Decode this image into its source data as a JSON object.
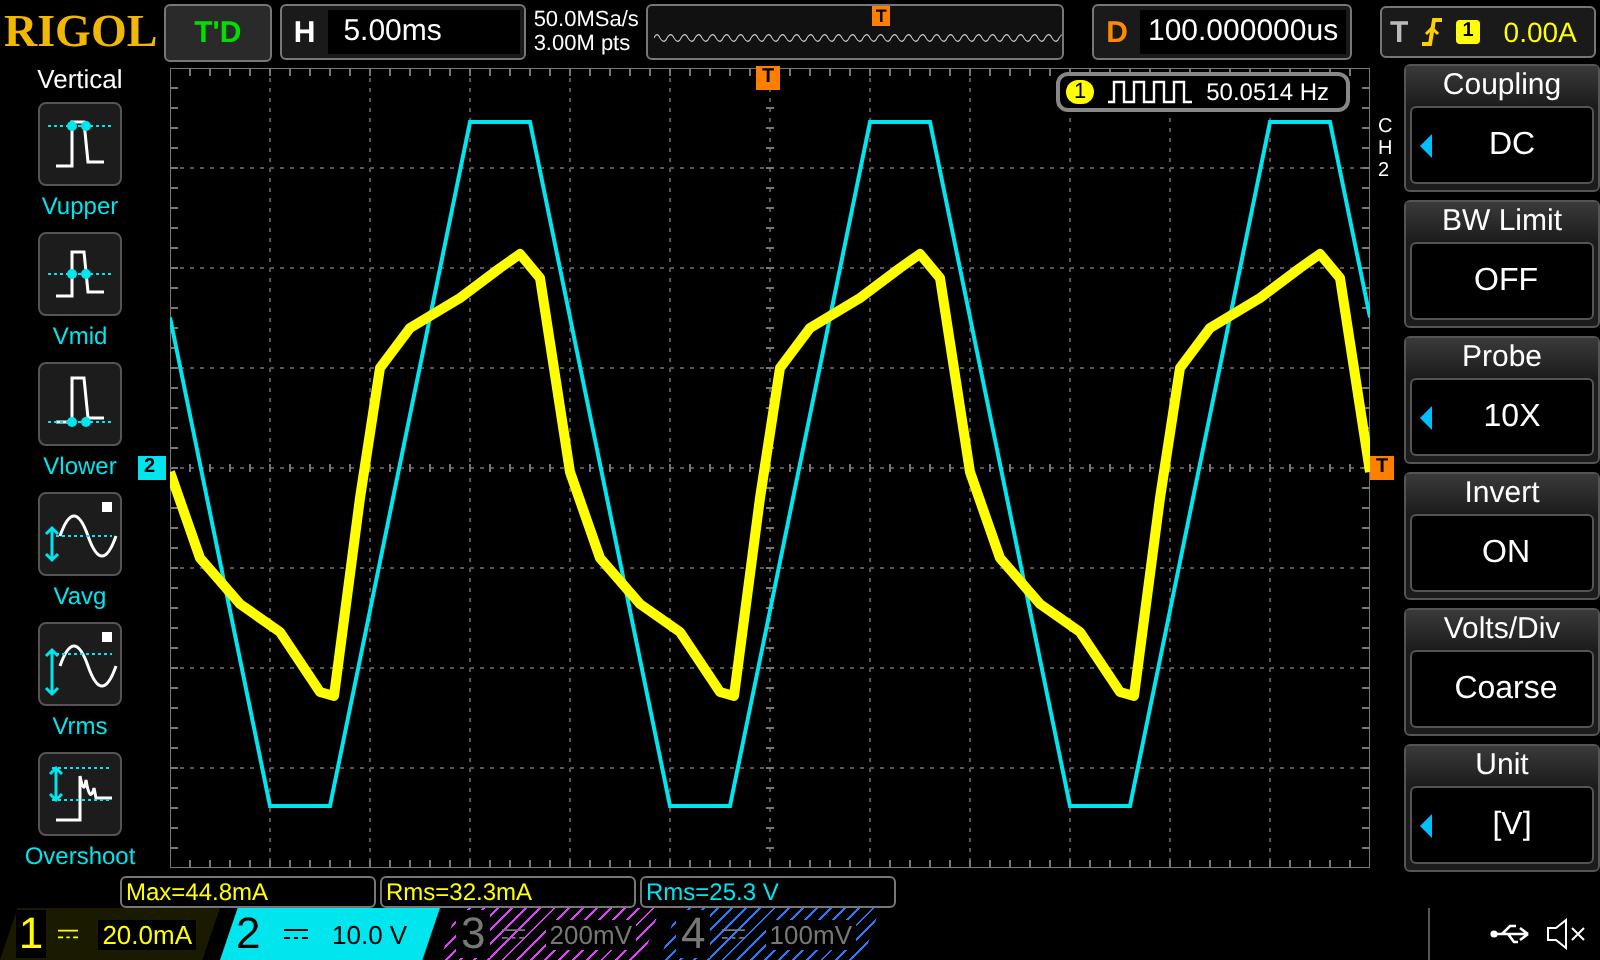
{
  "brand": "RIGOL",
  "trigger_status": "T'D",
  "horizontal": {
    "label": "H",
    "value": "5.00ms"
  },
  "acquisition": {
    "sample_rate": "50.0MSa/s",
    "memory_depth": "3.00M pts"
  },
  "delay": {
    "label": "D",
    "value": "100.000000us"
  },
  "trigger": {
    "label": "T",
    "source": "1",
    "level": "0.00A"
  },
  "left_menu": {
    "title": "Vertical",
    "items": [
      {
        "label": "Vupper",
        "kind": "upper"
      },
      {
        "label": "Vmid",
        "kind": "mid"
      },
      {
        "label": "Vlower",
        "kind": "lower"
      },
      {
        "label": "Vavg",
        "kind": "avg"
      },
      {
        "label": "Vrms",
        "kind": "rms"
      },
      {
        "label": "Overshoot",
        "kind": "overshoot"
      }
    ]
  },
  "markers": {
    "overview_trigger": "T",
    "channel_2": "2",
    "trigger_position": "T",
    "trigger_level": "T"
  },
  "frequency": {
    "channel": "1",
    "value": "50.0514 Hz"
  },
  "channel_tab": "CH2",
  "right_menu": [
    {
      "title": "Coupling",
      "value": "DC",
      "arrow": true
    },
    {
      "title": "BW Limit",
      "value": "OFF",
      "arrow": false
    },
    {
      "title": "Probe",
      "value": "10X",
      "arrow": true
    },
    {
      "title": "Invert",
      "value": "ON",
      "arrow": false
    },
    {
      "title": "Volts/Div",
      "value": "Coarse",
      "arrow": false
    },
    {
      "title": "Unit",
      "value": "[V]",
      "arrow": true
    }
  ],
  "measurements": [
    {
      "text": "Max=44.8mA",
      "color": "#ffff00"
    },
    {
      "text": "Rms=32.3mA",
      "color": "#ffff00"
    },
    {
      "text": "Rms=25.3 V",
      "color": "#00e5ee"
    }
  ],
  "channels": [
    {
      "number": "1",
      "scale": "20.0mA",
      "on": true,
      "selected": false,
      "color": "#ffff00"
    },
    {
      "number": "2",
      "scale": "10.0 V",
      "on": true,
      "selected": true,
      "color": "#00e5ee"
    },
    {
      "number": "3",
      "scale": "200mV",
      "on": false,
      "selected": false,
      "color": "#e040fb"
    },
    {
      "number": "4",
      "scale": "100mV",
      "on": false,
      "selected": false,
      "color": "#2979ff"
    }
  ]
}
